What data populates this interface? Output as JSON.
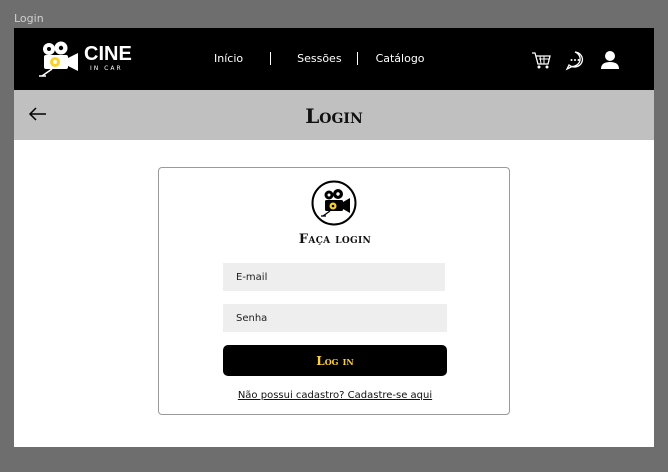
{
  "frame": {
    "label": "Login"
  },
  "navbar": {
    "brand": {
      "name": "CINE",
      "subtitle": "IN CAR"
    },
    "links": [
      {
        "label": "Início"
      },
      {
        "label": "Sessões"
      },
      {
        "label": "Catálogo"
      }
    ],
    "icons": [
      "cart-icon",
      "chat-icon",
      "user-icon"
    ]
  },
  "titlebar": {
    "title": "Login",
    "back_icon": "arrow-left-icon"
  },
  "login_card": {
    "logo_icon": "film-camera-icon",
    "heading": "Faça login",
    "email_placeholder": "E-mail",
    "password_placeholder": "Senha",
    "submit_label": "Log in",
    "signup_link": "Não possui cadastro? Cadastre-se aqui"
  },
  "colors": {
    "background": "#6e6e6e",
    "navbar": "#000000",
    "titlebar": "#c0c0c0",
    "input": "#eeeeee",
    "accent": "#ffd21f"
  }
}
